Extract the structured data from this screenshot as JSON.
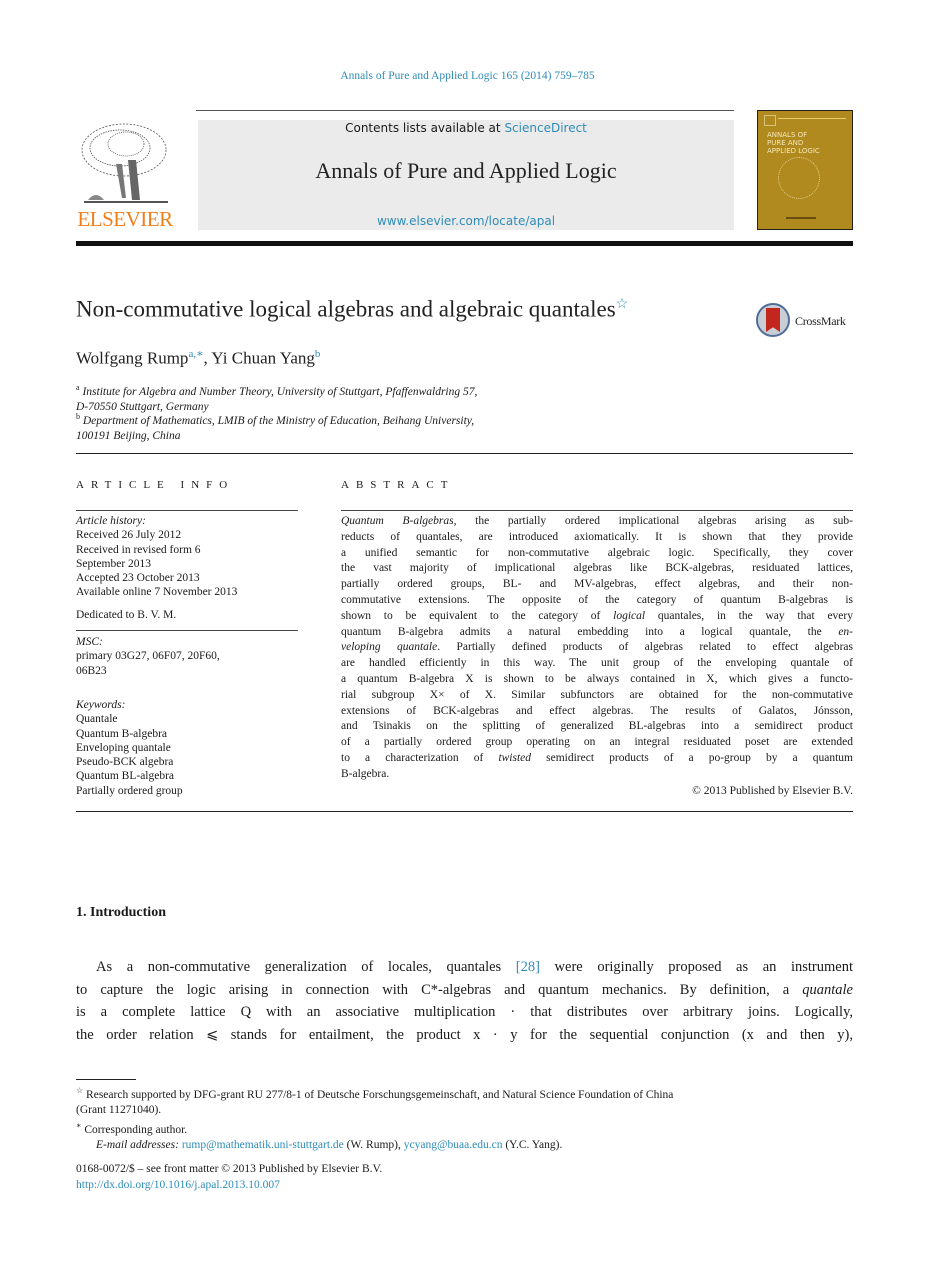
{
  "header": {
    "journal_ref": "Annals of Pure and Applied Logic 165 (2014) 759–785",
    "publisher_logo_text": "ELSEVIER",
    "contents_prefix": "Contents lists available at ",
    "contents_link": "ScienceDirect",
    "journal_title": "Annals of Pure and Applied Logic",
    "journal_url": "www.elsevier.com/locate/apal",
    "cover_title_lines": [
      "ANNALS OF",
      "PURE AND",
      "APPLIED LOGIC"
    ]
  },
  "colors": {
    "link": "#2f8cb8",
    "elsevier_orange": "#f07e1b",
    "banner_gray": "#ebebeb",
    "cover_gold": "#b08a1e",
    "crossmark_red": "#c3261d"
  },
  "article": {
    "title": "Non-commutative logical algebras and algebraic quantales",
    "title_note_mark": "☆",
    "crossmark_label": "CrossMark",
    "authors": [
      {
        "name": "Wolfgang Rump",
        "marks": "a,∗"
      },
      {
        "name": "Yi Chuan Yang",
        "marks": "b"
      }
    ],
    "author_separator": ", ",
    "affiliations": [
      {
        "mark": "a",
        "lines": [
          "Institute for Algebra and Number Theory, University of Stuttgart, Pfaffenwaldring 57,",
          "D-70550 Stuttgart, Germany"
        ]
      },
      {
        "mark": "b",
        "lines": [
          "Department of Mathematics, LMIB of the Ministry of Education, Beihang University,",
          "100191 Beijing, China"
        ]
      }
    ]
  },
  "article_info": {
    "heading": "ARTICLE INFO",
    "history_label": "Article history:",
    "history": [
      "Received 26 July 2012",
      "Received in revised form 6",
      "September 2013",
      "Accepted 23 October 2013",
      "Available online 7 November 2013"
    ],
    "dedication": "Dedicated to B. V. M.",
    "msc_label": "MSC:",
    "msc_lines": [
      "primary 03G27, 06F07, 20F60,",
      "06B23"
    ],
    "keywords_label": "Keywords:",
    "keywords": [
      "Quantale",
      "Quantum B-algebra",
      "Enveloping quantale",
      "Pseudo-BCK algebra",
      "Quantum BL-algebra",
      "Partially ordered group"
    ]
  },
  "abstract": {
    "heading": "ABSTRACT",
    "lines": [
      {
        "pre_italic": "Quantum B-algebras",
        "text": ", the partially ordered implicational algebras arising as sub-"
      },
      {
        "text": "reducts of quantales, are introduced axiomatically. It is shown that they provide"
      },
      {
        "text": "a unified semantic for non-commutative algebraic logic. Specifically, they cover"
      },
      {
        "text": "the vast majority of implicational algebras like BCK-algebras, residuated lattices,"
      },
      {
        "text": "partially ordered groups, BL- and MV-algebras, effect algebras, and their non-"
      },
      {
        "text": "commutative extensions. The opposite of the category of quantum B-algebras is"
      },
      {
        "text": "shown to be equivalent to the category of ",
        "italic": "logical",
        "post": " quantales, in the way that every"
      },
      {
        "text": "quantum B-algebra admits a natural embedding into a logical quantale, the ",
        "italic": "en-"
      },
      {
        "pre_italic": "veloping quantale",
        "text": ". Partially defined products of algebras related to effect algebras"
      },
      {
        "text": "are handled efficiently in this way. The unit group of the enveloping quantale of"
      },
      {
        "text": "a quantum B-algebra X is shown to be always contained in X, which gives a functo-"
      },
      {
        "text": "rial subgroup X× of X. Similar subfunctors are obtained for the non-commutative"
      },
      {
        "text": "extensions of BCK-algebras and effect algebras. The results of Galatos, Jónsson,"
      },
      {
        "text": "and Tsinakis on the splitting of generalized BL-algebras into a semidirect product"
      },
      {
        "text": "of a partially ordered group operating on an integral residuated poset are extended"
      },
      {
        "text": "to a characterization of ",
        "italic": "twisted",
        "post": " semidirect products of a po-group by a quantum"
      },
      {
        "text": "B-algebra."
      }
    ],
    "copyright": "© 2013 Published by Elsevier B.V."
  },
  "introduction": {
    "heading": "1.  Introduction",
    "lines": [
      {
        "text": "As a non-commutative generalization of locales, quantales ",
        "cite": "[28]",
        "post": " were originally proposed as an instrument"
      },
      {
        "text": "to capture the logic arising in connection with C*-algebras and quantum mechanics. By definition, a ",
        "italic": "quantale"
      },
      {
        "text": "is a complete lattice Q with an associative multiplication · that distributes over arbitrary joins. Logically,"
      },
      {
        "text": "the order relation ⩽ stands for entailment, the product x · y for the sequential conjunction (x and then y),"
      }
    ]
  },
  "footnotes": {
    "funding_mark": "☆",
    "funding_text": "Research supported by DFG-grant RU 277/8-1 of Deutsche Forschungsgemeinschaft, and Natural Science Foundation of China",
    "funding_text_cont": "(Grant 11271040).",
    "corresponding_mark": "∗",
    "corresponding_text": "Corresponding author.",
    "email_label": "E-mail addresses:",
    "emails": [
      {
        "address": "rump@mathematik.uni-stuttgart.de",
        "owner": " (W. Rump), "
      },
      {
        "address": "ycyang@buaa.edu.cn",
        "owner": " (Y.C. Yang)."
      }
    ]
  },
  "front_matter": {
    "issn_line": "0168-0072/$ – see front matter  © 2013 Published by Elsevier B.V.",
    "doi": "http://dx.doi.org/10.1016/j.apal.2013.10.007"
  }
}
